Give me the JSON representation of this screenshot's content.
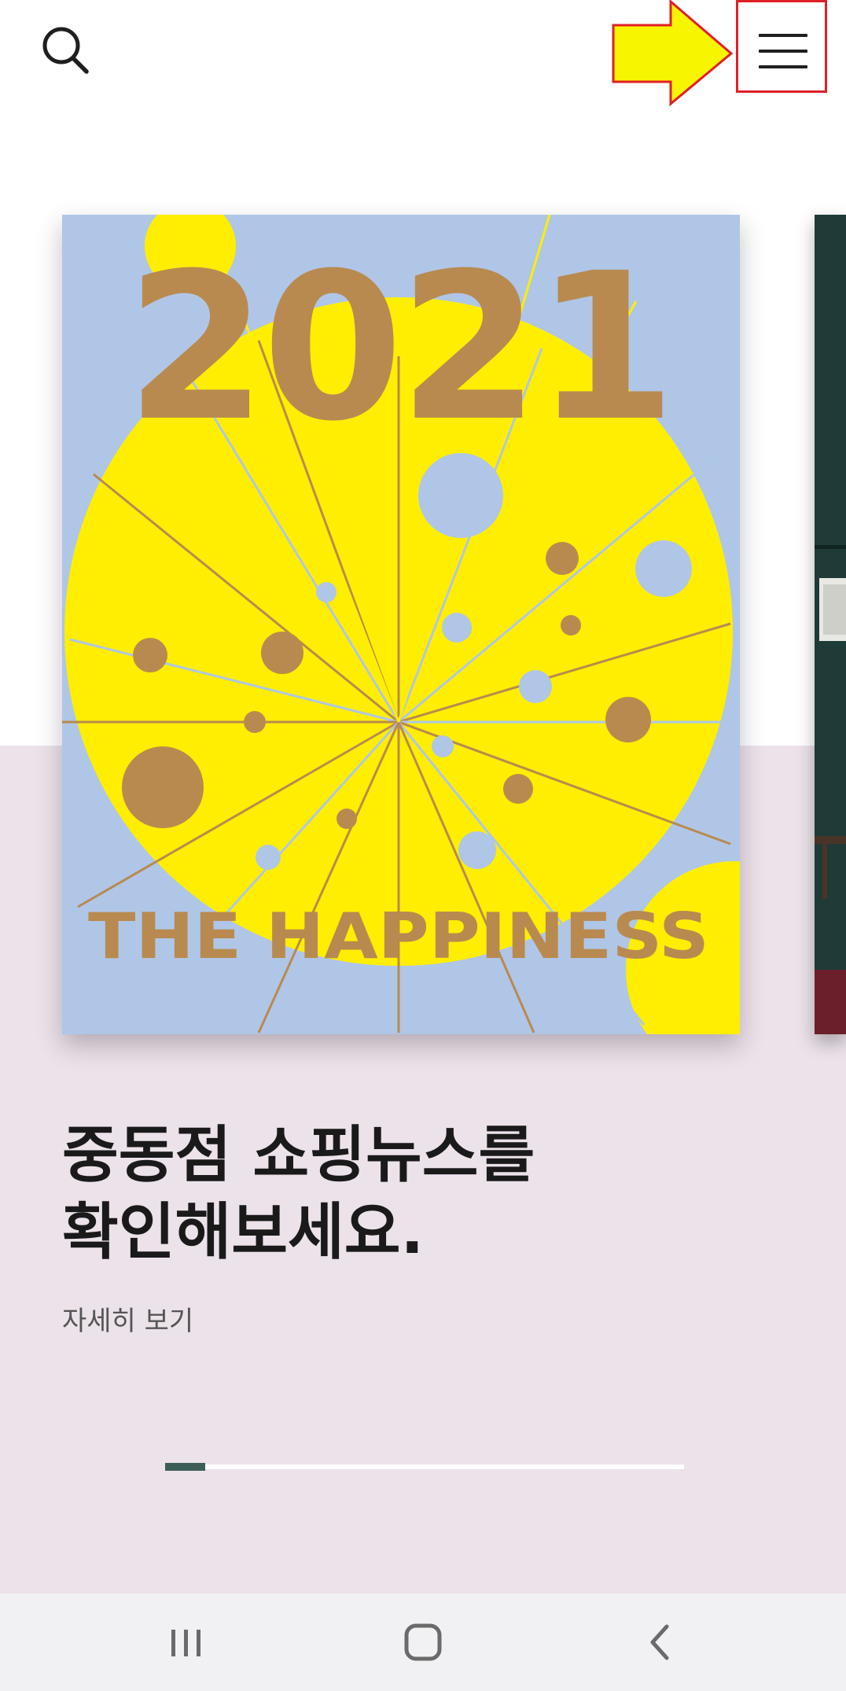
{
  "header": {
    "search_icon": "search-icon",
    "menu_icon": "hamburger-menu-icon",
    "annotation_color": "#e02027",
    "arrow_color": "#f7f500"
  },
  "banner": {
    "poster_year": "2021",
    "poster_caption": "THE HAPPINESS",
    "poster_colors": {
      "sky": "#afc6e7",
      "sun": "#ffee00",
      "brown": "#b98a4f"
    },
    "headline_line1": "중동점 쇼핑뉴스를",
    "headline_line2": "확인해보세요.",
    "detail_link": "자세히 보기",
    "background": "#ece2ea"
  },
  "slider": {
    "progress_fraction": 0.077,
    "active_color": "#3d5e58"
  },
  "system_nav": {
    "recent_apps": "recent-apps-icon",
    "home": "home-icon",
    "back": "back-icon"
  }
}
